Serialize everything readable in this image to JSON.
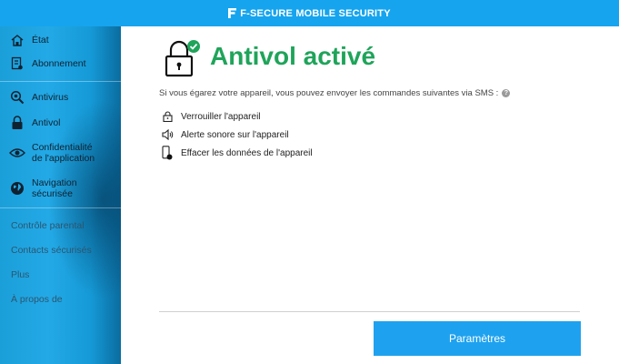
{
  "app": {
    "title": "F-SECURE MOBILE SECURITY"
  },
  "sidebar": {
    "items": [
      {
        "label": "État",
        "icon": "home-icon"
      },
      {
        "label": "Abonnement",
        "icon": "subscription-icon"
      },
      {
        "label": "Antivirus",
        "icon": "antivirus-icon"
      },
      {
        "label": "Antivol",
        "icon": "lock-icon"
      },
      {
        "label": "Confidentialité de l'application",
        "icon": "eye-icon"
      },
      {
        "label": "Navigation sécurisée",
        "icon": "globe-icon"
      }
    ],
    "links": [
      {
        "label": "Contrôle parental"
      },
      {
        "label": "Contacts sécurisés"
      },
      {
        "label": "Plus"
      },
      {
        "label": "À propos de"
      }
    ]
  },
  "main": {
    "title": "Antivol activé",
    "info": "Si vous égarez votre appareil, vous pouvez envoyer les commandes suivantes via SMS :",
    "commands": [
      {
        "label": "Verrouiller l'appareil",
        "icon": "lock-outline-icon"
      },
      {
        "label": "Alerte sonore sur l'appareil",
        "icon": "speaker-icon"
      },
      {
        "label": "Effacer les données de l'appareil",
        "icon": "phone-wipe-icon"
      }
    ],
    "button": "Paramètres"
  },
  "colors": {
    "topbar": "#16a4ee",
    "accent_green": "#1fa45a",
    "button": "#1ea2ef"
  }
}
